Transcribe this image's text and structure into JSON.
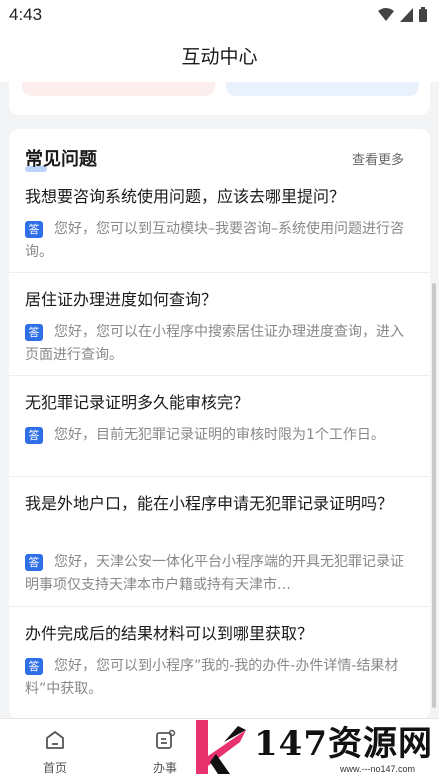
{
  "status_bar": {
    "time": "4:43"
  },
  "header": {
    "title": "互动中心"
  },
  "faq": {
    "title": "常见问题",
    "more": "查看更多",
    "badge": "答",
    "items": [
      {
        "q": "我想要咨询系统使用问题，应该去哪里提问？",
        "a": "您好，您可以到互动模块–我要咨询–系统使用问题进行咨询。"
      },
      {
        "q": "居住证办理进度如何查询？",
        "a": "您好，您可以在小程序中搜索居住证办理进度查询，进入页面进行查询。"
      },
      {
        "q": "无犯罪记录证明多久能审核完？",
        "a": "您好，目前无犯罪记录证明的审核时限为1个工作日。"
      },
      {
        "q": "我是外地户口，能在小程序申请无犯罪记录证明吗？",
        "a": "您好，天津公安一体化平台小程序端的开具无犯罪记录证明事项仅支持天津本市户籍或持有天津市…"
      },
      {
        "q": "办件完成后的结果材料可以到哪里获取？",
        "a": "您好，您可以到小程序”我的-我的办件-办件详情-结果材料”中获取。"
      }
    ]
  },
  "bottom_nav": {
    "home": "首页",
    "affairs": "办事"
  },
  "watermark": {
    "text": "147资源网",
    "sub": "www.---no147.com"
  }
}
